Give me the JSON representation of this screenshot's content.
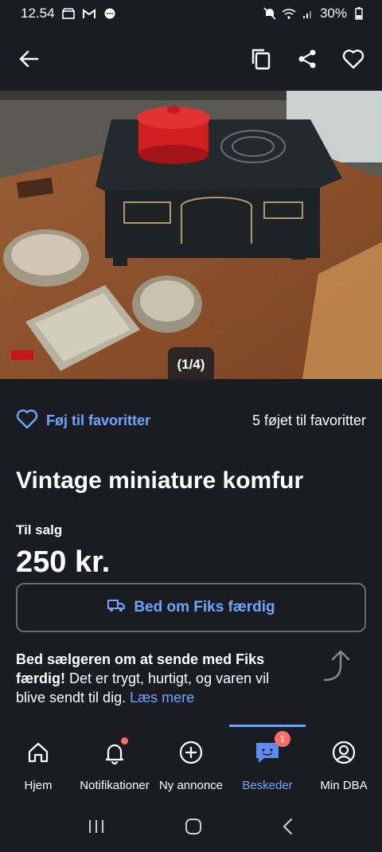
{
  "status_bar": {
    "time": "12.54",
    "battery": "30%",
    "left_icons": [
      "store-icon",
      "gmail-icon",
      "chat-icon"
    ],
    "right_icons": [
      "mute-icon",
      "wifi-icon",
      "signal-icon",
      "battery-icon"
    ]
  },
  "topbar": {
    "icons": [
      "back-arrow-icon",
      "copy-icon",
      "share-icon",
      "heart-icon"
    ]
  },
  "photo": {
    "counter": "(1/4)"
  },
  "favorites": {
    "button_label": "Føj til favoritter",
    "count_text": "5 føjet til favoritter"
  },
  "listing": {
    "title": "Vintage miniature komfur",
    "sale_label": "Til salg",
    "price": "250 kr."
  },
  "fiks": {
    "button_label": "Bed om Fiks færdig",
    "info_bold": "Bed sælgeren om at sende med Fiks færdig!",
    "info_text": " Det er trygt, hurtigt, og varen vil blive sendt til dig. ",
    "info_link": "Læs mere"
  },
  "bottom_nav": {
    "items": [
      {
        "label": "Hjem",
        "icon": "home-icon"
      },
      {
        "label": "Notifikationer",
        "icon": "bell-icon"
      },
      {
        "label": "Ny annonce",
        "icon": "plus-circle-icon"
      },
      {
        "label": "Beskeder",
        "icon": "messages-icon",
        "badge": "1"
      },
      {
        "label": "Min DBA",
        "icon": "profile-icon"
      }
    ]
  },
  "colors": {
    "background": "#1b1b22",
    "accent": "#6aa8ff",
    "badge": "#ff6b6b"
  }
}
